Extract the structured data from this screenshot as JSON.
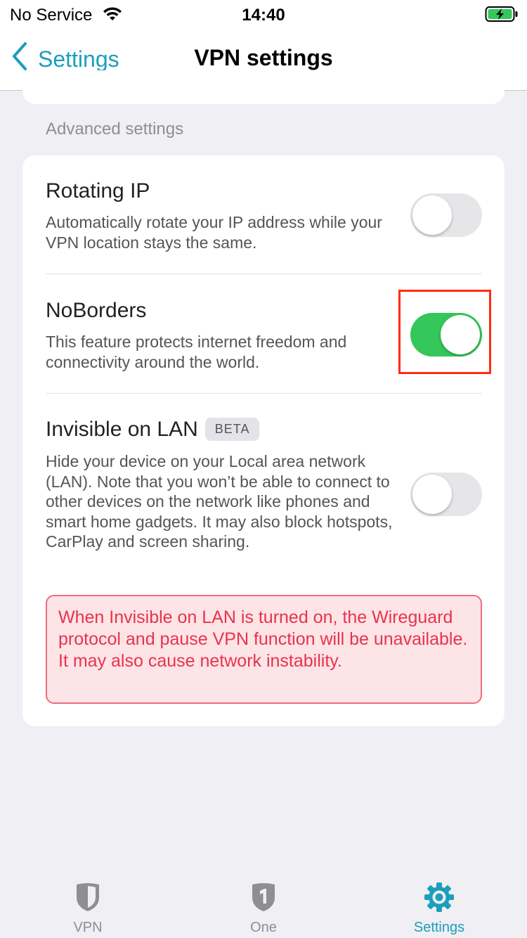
{
  "status_bar": {
    "carrier": "No Service",
    "time": "14:40"
  },
  "nav": {
    "back_label": "Settings",
    "title": "VPN settings"
  },
  "section": {
    "label": "Advanced settings"
  },
  "settings": [
    {
      "title": "Rotating IP",
      "description": "Automatically rotate your IP address while your VPN location stays the same.",
      "enabled": false
    },
    {
      "title": "NoBorders",
      "description": "This feature protects internet freedom and connectivity around the world.",
      "enabled": true
    },
    {
      "title": "Invisible on LAN",
      "badge": "BETA",
      "description": "Hide your device on your Local area network (LAN). Note that you won’t be able to connect to other devices on the network like phones and smart home gadgets. It may also block hotspots, CarPlay and screen sharing.",
      "enabled": false
    }
  ],
  "warning": "When Invisible on LAN is turned on, the Wireguard protocol and pause VPN function will be unavailable. It may also cause network instability.",
  "tabs": [
    {
      "label": "VPN",
      "icon": "shield-icon",
      "active": false
    },
    {
      "label": "One",
      "icon": "shield-one-icon",
      "active": false
    },
    {
      "label": "Settings",
      "icon": "gear-icon",
      "active": true
    }
  ],
  "colors": {
    "accent": "#1c9ebd",
    "toggle_on": "#34c759",
    "warning_text": "#e8334d",
    "highlight": "#ff2d10"
  }
}
